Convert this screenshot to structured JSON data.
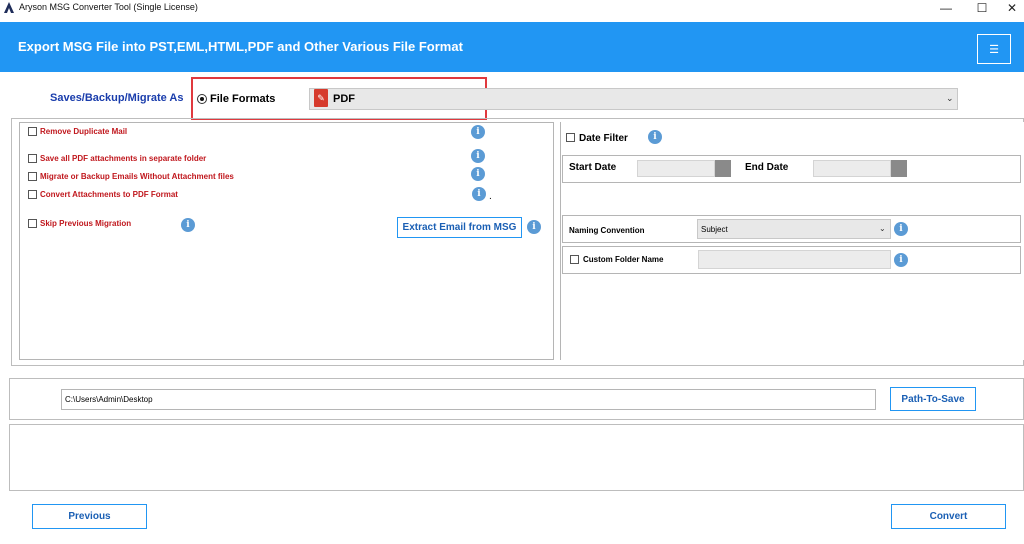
{
  "window": {
    "title": "Aryson MSG Converter Tool (Single License)",
    "minimize_glyph": "—",
    "maximize_glyph": "☐",
    "close_glyph": "✕"
  },
  "banner": {
    "title": "Export MSG File into PST,EML,HTML,PDF and Other Various File Format",
    "menu_glyph": "☰"
  },
  "saves_row": {
    "label": "Saves/Backup/Migrate As",
    "radio_label": "File Formats",
    "selected_format": "PDF",
    "chevron_glyph": "⌄"
  },
  "options": [
    {
      "label": "Remove Duplicate Mail",
      "checked": false
    },
    {
      "label": "Save all PDF attachments in separate folder",
      "checked": false
    },
    {
      "label": "Migrate or Backup Emails Without Attachment files",
      "checked": false
    },
    {
      "label": "Convert Attachments to PDF Format",
      "checked": false
    },
    {
      "label": "Skip Previous Migration",
      "checked": false
    }
  ],
  "info_glyph": "i",
  "trailing_dot": ".",
  "extract_button": "Extract Email from MSG",
  "date_filter": {
    "label": "Date Filter",
    "start_label": "Start Date",
    "end_label": "End Date"
  },
  "naming": {
    "label": "Naming Convention",
    "value": "Subject"
  },
  "custom_folder": {
    "label": "Custom Folder Name"
  },
  "path": {
    "value": "C:\\Users\\Admin\\Desktop",
    "button": "Path-To-Save"
  },
  "footer": {
    "previous": "Previous",
    "convert": "Convert"
  },
  "colors": {
    "banner": "#2196f3",
    "option_text": "#c0171d",
    "label_blue": "#1a3dac",
    "highlight": "#e0393e",
    "info": "#5b9bd5"
  }
}
